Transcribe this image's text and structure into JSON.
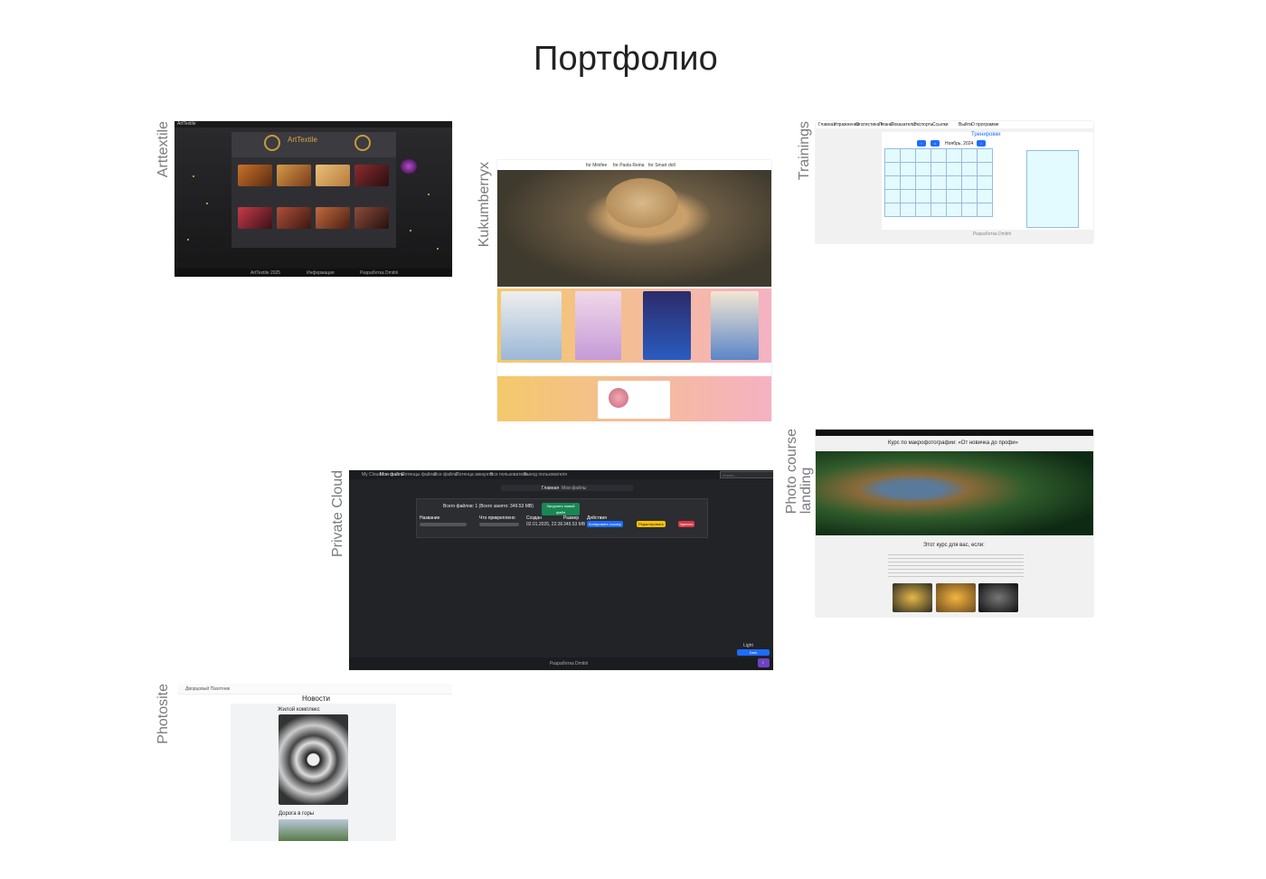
{
  "page": {
    "title": "Портфолио"
  },
  "projects": [
    {
      "label": "Arttextile",
      "screen": {
        "brand": "ArtTextile",
        "logo": "ArtTextile",
        "footer": [
          "ArtTextile 2025",
          "Информация",
          "Разработка Dmitrii"
        ]
      }
    },
    {
      "label": "Kukumberryx",
      "screen": {
        "tabs": [
          "for Minifee",
          "for Paola Reina",
          "for Smart doll"
        ]
      }
    },
    {
      "label": "Trainings",
      "screen": {
        "nav": [
          "Главная",
          "Упражнения",
          "Статистика ▾",
          "Планы",
          "Показатели",
          "Экспорты",
          "Ссылки",
          "Выйти",
          "О программе"
        ],
        "heading": "Тренировки",
        "month": "Ноябрь, 2024",
        "footer": "Разработка Dmitrii"
      }
    },
    {
      "label": "Photo course\nlanding",
      "screen": {
        "heading": "Курс по макрофотографии: «От новичка до профи»",
        "subheading": "Этот курс для вас, если:"
      }
    },
    {
      "label": "Private Cloud",
      "screen": {
        "nav": [
          "My Cloud",
          "Мои файлы",
          "Потенцы файлы",
          "Все файлы",
          "Потенца аккаунта",
          "Все пользователи",
          "Выход пользователя"
        ],
        "search_placeholder": "Искать...",
        "breadcrumb": [
          "Главная",
          "Мои файлы"
        ],
        "summary": "Всего файлов: 1 (Всего занято: 349.53 MB)",
        "upload_label": "Загрузить новый файл",
        "columns": [
          "Название",
          "Что прикреплено",
          "Создан",
          "Размер",
          "Действия"
        ],
        "row": {
          "created": "02.01.2025, 22:36",
          "size": "349.53 MB",
          "copy_link": "Копировать ссылку",
          "edit": "Редактировать",
          "delete": "Удалить"
        },
        "theme_light": "Light",
        "theme_dark": "Dark",
        "footer": "Разработка Dmitrii"
      }
    },
    {
      "label": "Photosite",
      "screen": {
        "heading": "Новости",
        "post1": "Жилой комплекс",
        "post2": "Дорога в горы",
        "brand": "Дворцовый Пахотник"
      }
    }
  ],
  "colors": {
    "accent_blue": "#1e6cff",
    "dark_bg": "#202226",
    "cyan_cell": "#e3fbff",
    "danger": "#dc3545",
    "warning": "#ffc107",
    "success": "#198754"
  }
}
